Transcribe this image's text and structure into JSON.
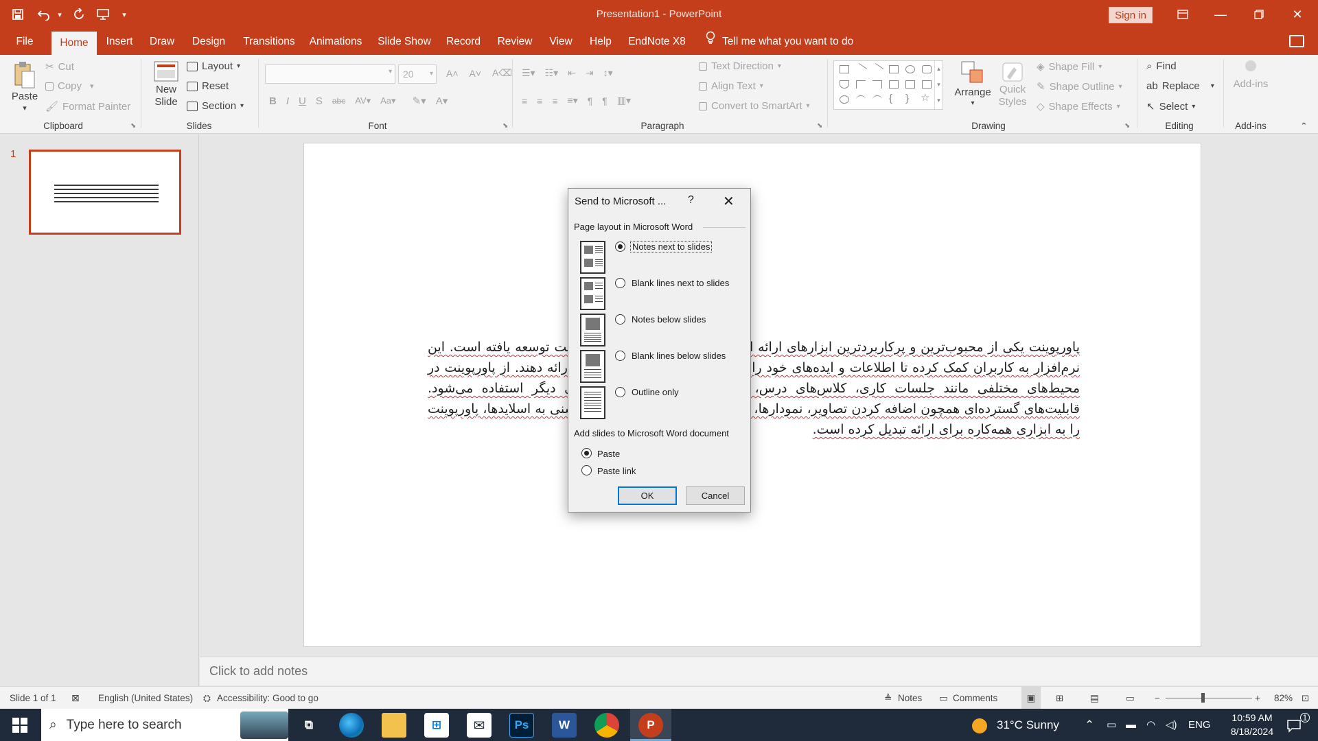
{
  "window": {
    "title": "Presentation1 - PowerPoint",
    "sign_in": "Sign in"
  },
  "qat": {
    "save": "save-icon",
    "undo": "undo-icon",
    "redo": "redo-icon",
    "present": "present-icon"
  },
  "menu": {
    "tabs": [
      "File",
      "Home",
      "Insert",
      "Draw",
      "Design",
      "Transitions",
      "Animations",
      "Slide Show",
      "Record",
      "Review",
      "View",
      "Help",
      "EndNote X8"
    ],
    "active": "Home",
    "tell_me": "Tell me what you want to do"
  },
  "ribbon": {
    "clipboard": {
      "paste": "Paste",
      "cut": "Cut",
      "copy": "Copy",
      "format_painter": "Format Painter",
      "label": "Clipboard"
    },
    "slides": {
      "new_slide_line1": "New",
      "new_slide_line2": "Slide",
      "layout": "Layout",
      "reset": "Reset",
      "section": "Section",
      "label": "Slides"
    },
    "font": {
      "size": "20",
      "label": "Font"
    },
    "paragraph": {
      "text_direction": "Text Direction",
      "align_text": "Align Text",
      "convert_smartart": "Convert to SmartArt",
      "label": "Paragraph"
    },
    "drawing": {
      "arrange": "Arrange",
      "quick_styles_line1": "Quick",
      "quick_styles_line2": "Styles",
      "shape_fill": "Shape Fill",
      "shape_outline": "Shape Outline",
      "shape_effects": "Shape Effects",
      "label": "Drawing"
    },
    "editing": {
      "find": "Find",
      "replace": "Replace",
      "select": "Select",
      "label": "Editing"
    },
    "addins": {
      "button": "Add-ins",
      "label": "Add-ins"
    }
  },
  "slides_panel": {
    "number": "1"
  },
  "slide": {
    "text": "پاورپوینت یکی از محبوب‌ترین و پرکاربردترین ابزارهای ارائه است که توسط شرکت مایکروسافت توسعه یافته است. این نرم‌افزار به کاربران کمک کرده تا اطلاعات و ایده‌های خود را به صورت بصری و سازمان‌یافته ارائه دهند. از پاورپوینت در محیط‌های مختلفی مانند جلسات کاری، کلاس‌های درس، کنفرانس‌ها، سمینارها و بسیاری دیگر استفاده می‌شود. قابلیت‌های گسترده‌ای همچون اضافه کردن تصاویر، نمودارها، جداول، ویدئوها و افکت‌های انیمیشنی به اسلایدها، پاورپوینت را به ابزاری همه‌کاره برای ارائه تبدیل کرده است."
  },
  "notes": {
    "placeholder": "Click to add notes"
  },
  "status": {
    "slide_of": "Slide 1 of 1",
    "language": "English (United States)",
    "accessibility": "Accessibility: Good to go",
    "notes": "Notes",
    "comments": "Comments",
    "zoom": "82%"
  },
  "dialog": {
    "title": "Send to Microsoft ...",
    "help": "?",
    "layout_heading": "Page layout in Microsoft Word",
    "options": [
      {
        "label": "Notes next to slides",
        "selected": true
      },
      {
        "label": "Blank lines next to slides",
        "selected": false
      },
      {
        "label": "Notes below slides",
        "selected": false
      },
      {
        "label": "Blank lines below slides",
        "selected": false
      },
      {
        "label": "Outline only",
        "selected": false
      }
    ],
    "add_heading": "Add slides to Microsoft Word document",
    "paste_options": [
      {
        "label": "Paste",
        "selected": true
      },
      {
        "label": "Paste link",
        "selected": false
      }
    ],
    "ok": "OK",
    "cancel": "Cancel"
  },
  "taskbar": {
    "search_placeholder": "Type here to search",
    "apps": [
      "task-view-icon",
      "edge-icon",
      "file-explorer-icon",
      "store-icon",
      "mail-icon",
      "photoshop-icon",
      "word-icon",
      "chrome-icon",
      "powerpoint-icon"
    ],
    "photoshop": "Ps",
    "word": "W",
    "powerpoint": "P",
    "weather": "31°C  Sunny",
    "lang": "ENG",
    "time": "10:59 AM",
    "date": "8/18/2024",
    "notif_count": "1"
  },
  "colors": {
    "accent": "#c43e1c",
    "dialog_bg": "#f0f0f0",
    "taskbar": "#1f2b3a"
  }
}
